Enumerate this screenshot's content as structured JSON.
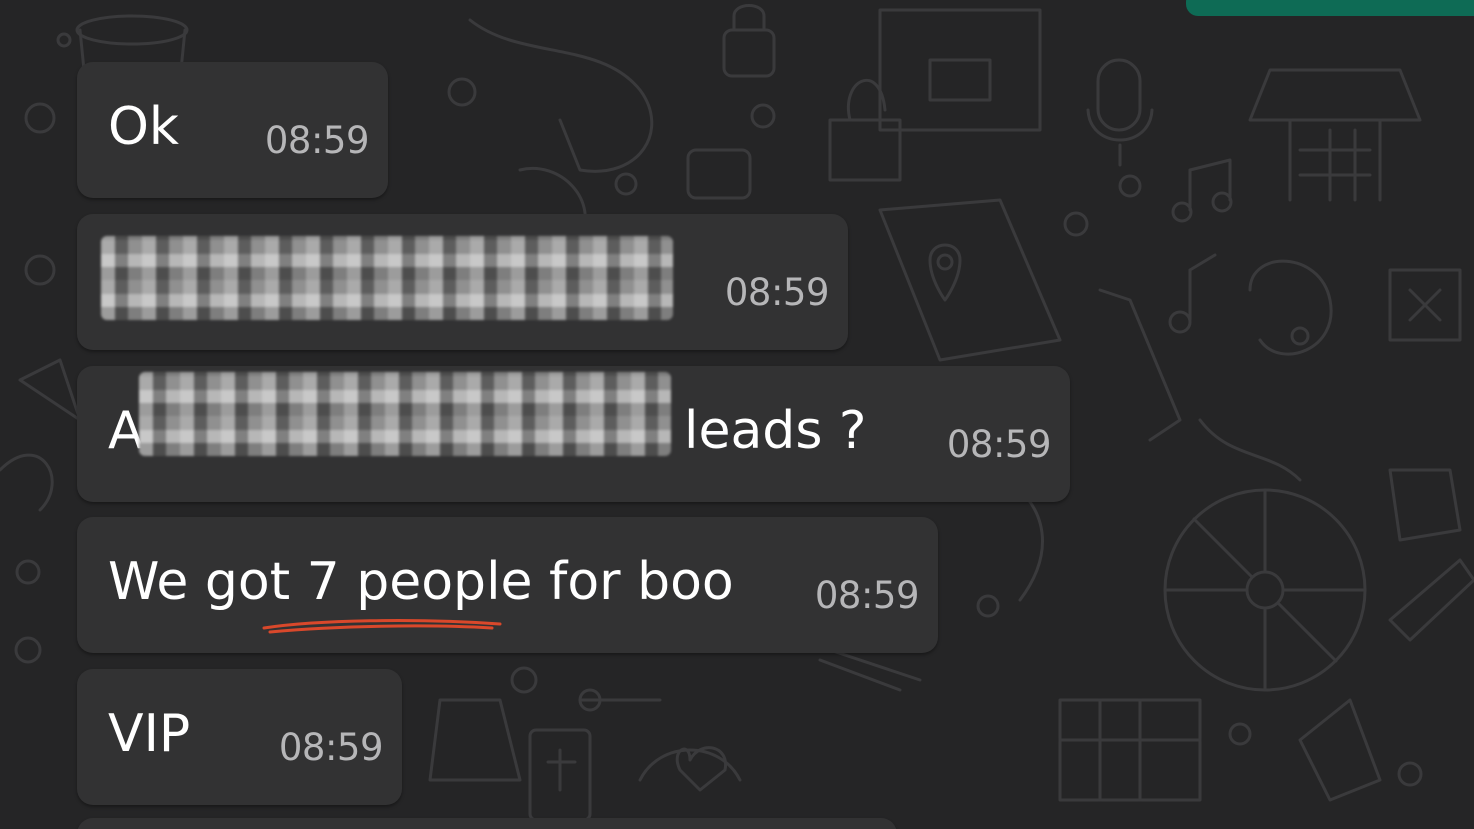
{
  "chat": {
    "messages": [
      {
        "text": "Ok",
        "time": "08:59"
      },
      {
        "text": "",
        "time": "08:59",
        "redacted": true
      },
      {
        "text_before": "A",
        "text_after": " leads ?",
        "time": "08:59",
        "redacted": true
      },
      {
        "text": "We got 7 people for boo",
        "time": "08:59"
      },
      {
        "text": "VIP",
        "time": "08:59"
      }
    ]
  },
  "colors": {
    "background": "#252526",
    "bubble": "#323233",
    "text": "#ffffff",
    "time": "#b6b6b8",
    "outgoing_bubble": "#0e6b55",
    "annotation_underline": "#d9482b"
  }
}
